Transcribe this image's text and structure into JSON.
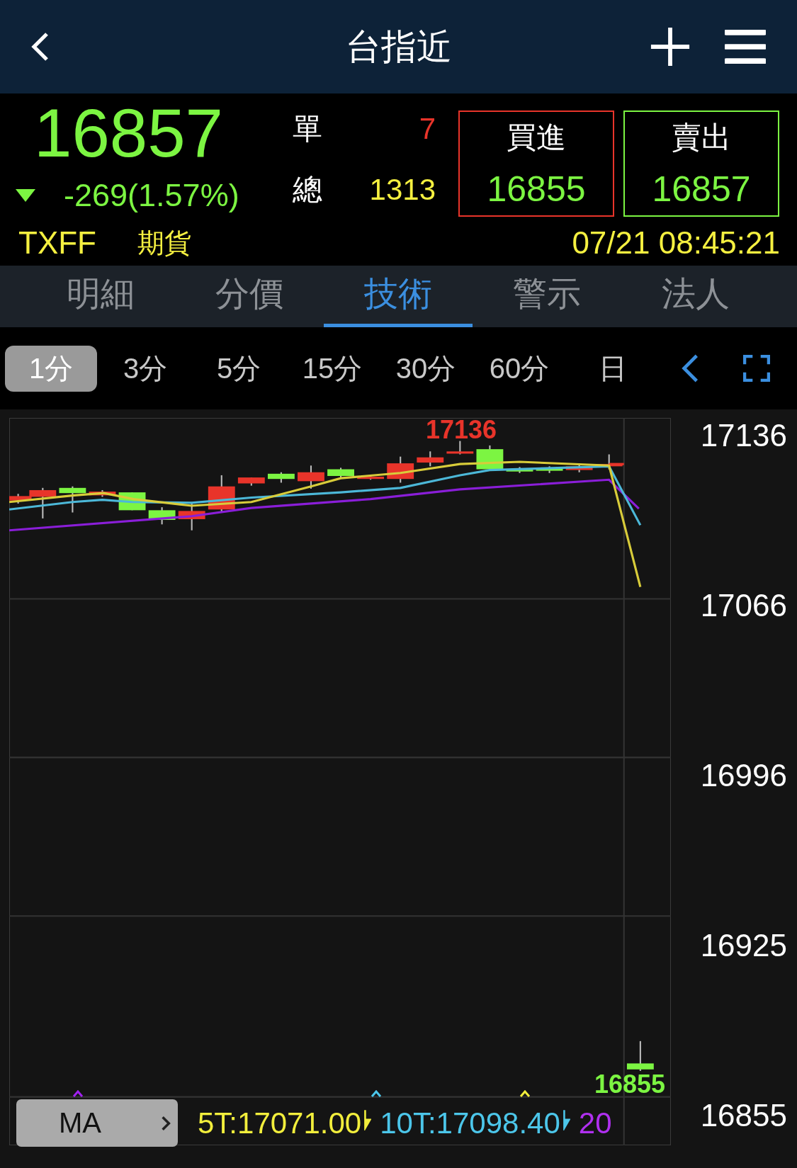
{
  "header": {
    "title": "台指近"
  },
  "quote": {
    "price": "16857",
    "change": "-269(1.57%)",
    "single_label": "單",
    "single_value": "7",
    "total_label": "總",
    "total_value": "1313",
    "symbol": "TXFF",
    "market": "期貨",
    "timestamp": "07/21 08:45:21"
  },
  "bid_ask": [
    {
      "kind": "buy",
      "label": "買進",
      "price": "16855"
    },
    {
      "kind": "sell",
      "label": "賣出",
      "price": "16857"
    }
  ],
  "tabs": [
    {
      "label": "明細",
      "selected": false
    },
    {
      "label": "分價",
      "selected": false
    },
    {
      "label": "技術",
      "selected": true
    },
    {
      "label": "警示",
      "selected": false
    },
    {
      "label": "法人",
      "selected": false
    }
  ],
  "intervals": [
    {
      "label": "1分",
      "selected": true
    },
    {
      "label": "3分",
      "selected": false
    },
    {
      "label": "5分",
      "selected": false
    },
    {
      "label": "15分",
      "selected": false
    },
    {
      "label": "30分",
      "selected": false
    },
    {
      "label": "60分",
      "selected": false
    },
    {
      "label": "日",
      "selected": false
    }
  ],
  "chart": {
    "high_label": "17136",
    "low_label": "16855",
    "price_axis": [
      "17136",
      "17066",
      "16996",
      "16925",
      "16855"
    ],
    "indicator": {
      "button": "MA",
      "values": [
        {
          "text": "5T:17071.00",
          "color": "#f2ee3c",
          "arrow": true
        },
        {
          "text": "10T:17098.40",
          "color": "#4cc6ea",
          "arrow": true
        },
        {
          "text": "20",
          "color": "#b030f0",
          "arrow": false
        }
      ]
    }
  }
}
